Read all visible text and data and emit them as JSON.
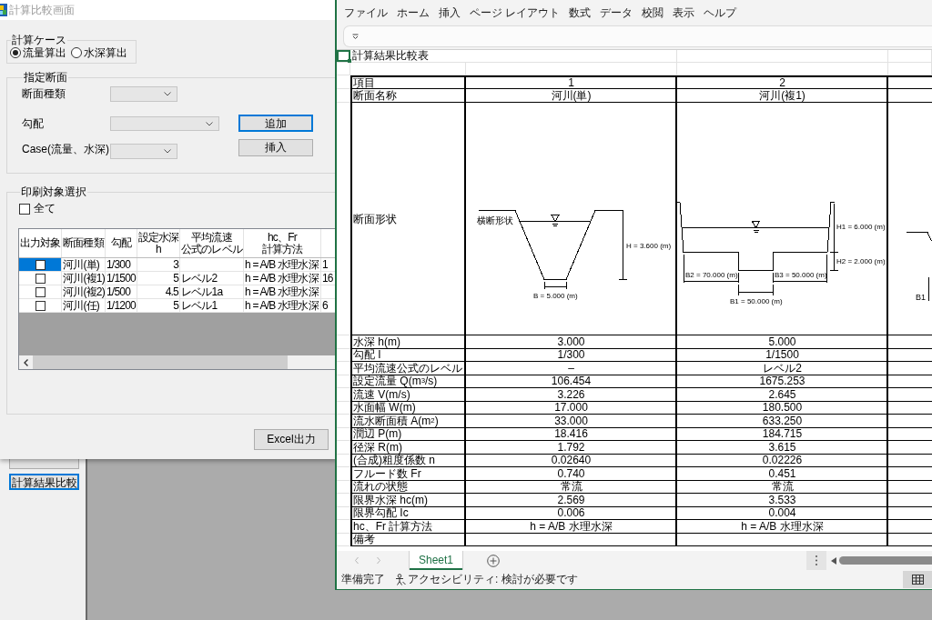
{
  "background_app": {
    "buttons": [
      {
        "focused": false
      },
      {
        "label": "計算結果比較",
        "focused": true
      }
    ]
  },
  "dialog": {
    "title": "計算比較画面",
    "active": false,
    "calc_case": {
      "label": "計算ケース",
      "options": [
        {
          "label": "流量算出",
          "selected": true
        },
        {
          "label": "水深算出",
          "selected": false
        }
      ]
    },
    "section": {
      "label": "指定断面",
      "fields": [
        {
          "label": "断面種類"
        },
        {
          "label": "勾配"
        },
        {
          "label": "Case(流量、水深)"
        }
      ],
      "buttons": [
        {
          "label": "追加",
          "focused": true
        },
        {
          "label": "挿入",
          "focused": false
        }
      ]
    },
    "print_selection": {
      "label": "印刷対象選択",
      "select_all": {
        "label": "全て",
        "checked": false
      },
      "grid": {
        "columns": [
          [
            "出力対象"
          ],
          [
            "断面種類"
          ],
          [
            "勾配"
          ],
          [
            "設定水深",
            "h"
          ],
          [
            "平均流速",
            "公式のレベル"
          ],
          [
            "hc、Fr",
            "計算方法"
          ]
        ],
        "rows": [
          {
            "selected": true,
            "checked": false,
            "section_type": "河川(単)",
            "slope": "1/300",
            "depth": "3",
            "method": "h = A/B 水理水深",
            "column_7": "1"
          },
          {
            "selected": false,
            "checked": false,
            "section_type": "河川(複1)",
            "slope": "1/1500",
            "depth": "5",
            "velocity_level": "レベル2",
            "method": "h = A/B 水理水深",
            "column_7": "16"
          },
          {
            "selected": false,
            "checked": false,
            "section_type": "河川(複2)",
            "slope": "1/500",
            "depth": "4.5",
            "velocity_level": "レベル1a",
            "method": "h = A/B 水理水深"
          },
          {
            "selected": false,
            "checked": false,
            "section_type": "河川(任)",
            "slope": "1/1200",
            "depth": "5",
            "velocity_level": "レベル1",
            "method": "h = A/B 水理水深",
            "column_7": "6"
          }
        ]
      }
    },
    "export_button": {
      "label": "Excel出力"
    }
  },
  "excel": {
    "menu": [
      "ファイル",
      "ホーム",
      "挿入",
      "ページ レイアウト",
      "数式",
      "データ",
      "校閲",
      "表示",
      "ヘルプ"
    ],
    "sheet": {
      "title_cell": "計算結果比較表",
      "header_row": {
        "label": "項目",
        "values": [
          "1",
          "2"
        ]
      },
      "name_row": {
        "label": "断面名称",
        "values": [
          "河川(単)",
          "河川(複1)"
        ]
      },
      "shape_row": {
        "label": "断面形状",
        "shapes": [
          {
            "kind": "trapezoid",
            "caption": "横断形状",
            "height": "H = 3.600 (m)",
            "width": "B = 5.000 (m)"
          },
          {
            "kind": "compound",
            "h1": "H1 = 6.000 (m)",
            "h2": "H2 = 2.000 (m)",
            "b2": "B2 = 70.000 (m)",
            "b1": "B1 = 50.000 (m)",
            "b3": "B3 = 50.000 (m)"
          },
          {
            "kind": "cut_off",
            "b1": "B1"
          }
        ]
      },
      "rows": [
        {
          "label": "水深 h(m)",
          "values": [
            "3.000",
            "5.000"
          ]
        },
        {
          "label": "勾配 I",
          "values": [
            "1/300",
            "1/1500"
          ]
        },
        {
          "label": "平均流速公式のレベル",
          "values": [
            "–",
            "レベル2"
          ]
        },
        {
          "label": "設定流量 Q(m$^{3}$/s)",
          "values": [
            "106.454",
            "1675.253"
          ]
        },
        {
          "label": "流速 V(m/s)",
          "values": [
            "3.226",
            "2.645"
          ]
        },
        {
          "label": "水面幅 W(m)",
          "values": [
            "17.000",
            "180.500"
          ]
        },
        {
          "label": "流水断面積 A(m$^{2}$)",
          "values": [
            "33.000",
            "633.250"
          ]
        },
        {
          "label": "潤辺 P(m)",
          "values": [
            "18.416",
            "184.715"
          ]
        },
        {
          "label": "径深 R(m)",
          "values": [
            "1.792",
            "3.615"
          ]
        },
        {
          "label": "(合成)粗度係数 n",
          "values": [
            "0.02640",
            "0.02226"
          ]
        },
        {
          "label": "フルード数 Fr",
          "values": [
            "0.740",
            "0.451"
          ]
        },
        {
          "label": "流れの状態",
          "values": [
            "常流",
            "常流"
          ]
        },
        {
          "label": "限界水深 hc(m)",
          "values": [
            "2.569",
            "3.533"
          ]
        },
        {
          "label": "限界勾配 Ic",
          "values": [
            "0.006",
            "0.004"
          ]
        },
        {
          "label": "hc、Fr 計算方法",
          "values": [
            "h = A/B 水理水深",
            "h = A/B 水理水深"
          ]
        },
        {
          "label": "備考"
        }
      ]
    },
    "sheet_tabs": [
      {
        "label": "Sheet1",
        "selected": true
      }
    ],
    "status_bar": {
      "status": "準備完了",
      "accessibility": "アクセシビリティ: 検討が必要です"
    }
  }
}
